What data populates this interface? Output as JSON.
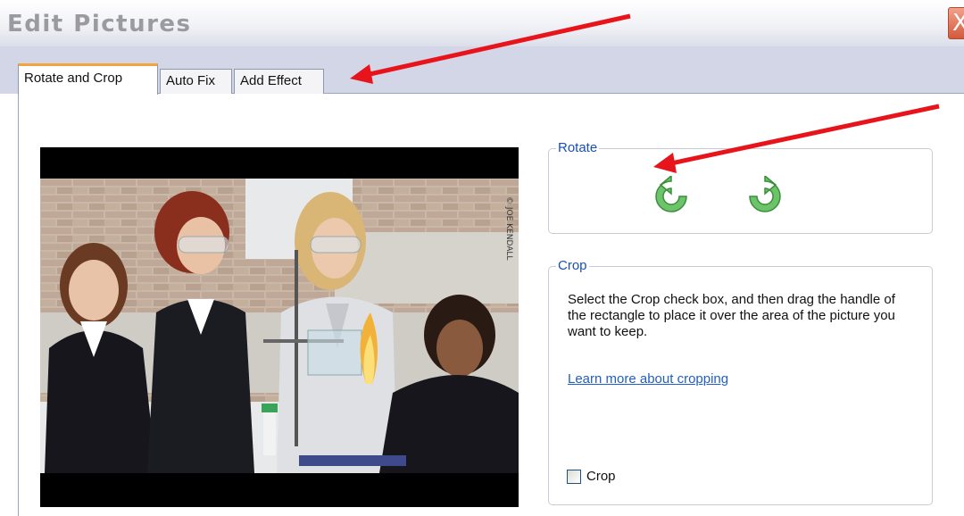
{
  "window": {
    "title": "Edit Pictures",
    "close_glyph": "X"
  },
  "tabs": [
    {
      "label": "Rotate and Crop",
      "active": true
    },
    {
      "label": "Auto Fix",
      "active": false
    },
    {
      "label": "Add Effect",
      "active": false
    }
  ],
  "photo": {
    "watermark": "© JOE KENDALL"
  },
  "rotate": {
    "legend": "Rotate",
    "left_icon": "rotate-left-icon",
    "right_icon": "rotate-right-icon"
  },
  "crop": {
    "legend": "Crop",
    "description": "Select the Crop check box, and then drag the handle of the rectangle to place it over the area of the picture you want to keep.",
    "link_text": "Learn more about cropping",
    "checkbox_label": "Crop",
    "checked": false
  },
  "annotations": {
    "arrow_color": "#e8141b"
  },
  "colors": {
    "tab_accent": "#f1a53c",
    "legend_blue": "#1a4fb6",
    "link_blue": "#1f5fc6",
    "icon_green": "#5bb85a"
  }
}
